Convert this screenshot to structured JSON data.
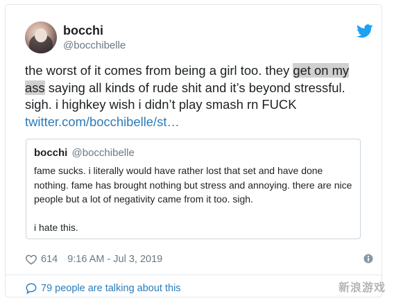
{
  "user": {
    "display_name": "bocchi",
    "handle": "@bocchibelle"
  },
  "tweet": {
    "text_before": "the worst of it comes from being a girl too. they ",
    "text_highlight": "get on my ass",
    "text_after": " saying all kinds of rude shit and it’s beyond stressful. sigh. i highkey wish i didn’t play smash rn FUCK",
    "link": "twitter.com/bocchibelle/st…"
  },
  "quoted": {
    "display_name": "bocchi",
    "handle": "@bocchibelle",
    "text_1": "fame sucks. i literally would have rather lost that set and have done nothing. fame has brought nothing but stress and annoying. there are nice people but a lot of negativity came from it too. sigh.",
    "text_2": "i hate this."
  },
  "meta": {
    "likes": "614",
    "timestamp": "9:16 AM - Jul 3, 2019"
  },
  "footer": {
    "talking": "79 people are talking about this"
  },
  "watermark": "新浪游戏",
  "icons": {
    "brand": "twitter-bird-icon",
    "like": "heart-icon",
    "info": "info-icon",
    "conversation": "speech-bubble-icon"
  },
  "colors": {
    "link": "#2b7bb9",
    "twitter_blue": "#1da1f2",
    "muted": "#697882",
    "highlight": "#d0d0d0"
  }
}
